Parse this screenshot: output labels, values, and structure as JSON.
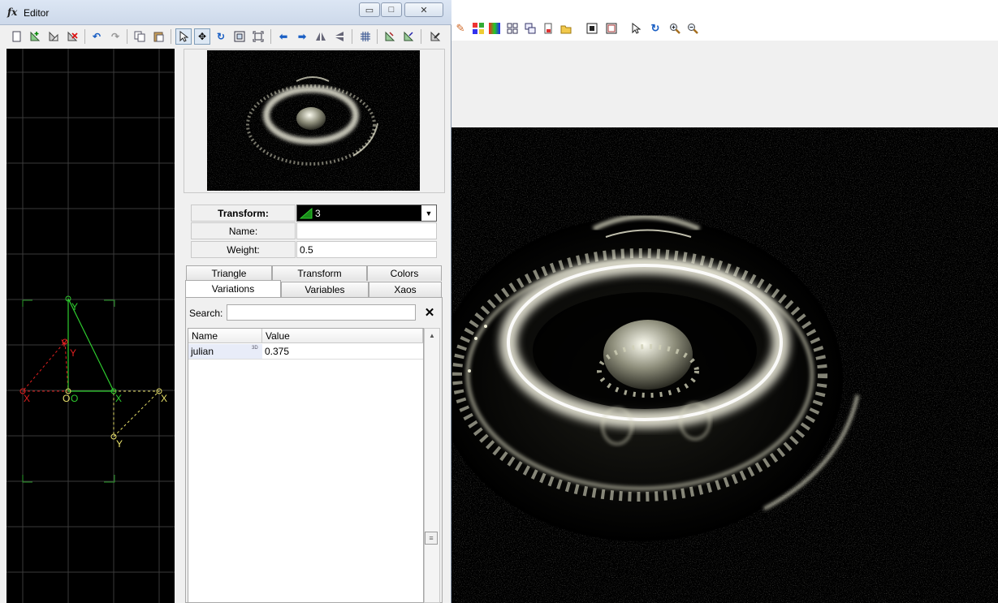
{
  "editor": {
    "title": "Editor",
    "title_icon": "fx",
    "window_buttons": {
      "minimize": "▭",
      "maximize": "□",
      "close": "✕"
    }
  },
  "toolbar": {
    "icons": [
      "new-transform-icon",
      "add-transform-icon",
      "duplicate-transform-icon",
      "delete-transform-icon",
      "undo-icon",
      "redo-icon",
      "copy-icon",
      "paste-icon",
      "select-pointer-icon",
      "move-icon",
      "rotate-icon",
      "scale-icon",
      "fit-icon",
      "flip-left-icon",
      "flip-right-icon",
      "mirror-horizontal-icon",
      "mirror-vertical-icon",
      "grid-icon",
      "post-transform-icon",
      "reset-transform-icon",
      "edit-icon"
    ]
  },
  "triangle_labels": {
    "red_x": "X",
    "red_y": "Y",
    "red_y2": "Y",
    "green_y": "Y",
    "green_x": "X",
    "o1": "O",
    "o2": "O",
    "yellow_x": "X",
    "yellow_y": "Y"
  },
  "properties": {
    "transform_label": "Transform:",
    "transform_value": "3",
    "name_label": "Name:",
    "name_value": "",
    "weight_label": "Weight:",
    "weight_value": "0.5"
  },
  "tabs": {
    "row1": [
      "Triangle",
      "Transform",
      "Colors"
    ],
    "row2": [
      "Variations",
      "Variables",
      "Xaos"
    ],
    "active": "Variations"
  },
  "variations": {
    "search_label": "Search:",
    "search_value": "",
    "clear": "✕",
    "columns": [
      "Name",
      "Value"
    ],
    "rows": [
      {
        "name": "julian",
        "tag": "3D",
        "value": "0.375"
      }
    ]
  },
  "main_toolbar": {
    "icons": [
      "edit-pencil-icon",
      "palette-grid-icon",
      "gradient-icon",
      "tiles-icon",
      "windows-icon",
      "document-icon",
      "folder-icon",
      "fullscreen-icon",
      "frame-icon",
      "pointer-icon",
      "rotate-icon",
      "zoom-in-icon",
      "zoom-out-icon"
    ]
  },
  "colors": {
    "fractal_glow": "#efeed7",
    "triangle_green": "#2ecc2e",
    "triangle_red": "#e02020",
    "triangle_yellow": "#e8e06a"
  }
}
